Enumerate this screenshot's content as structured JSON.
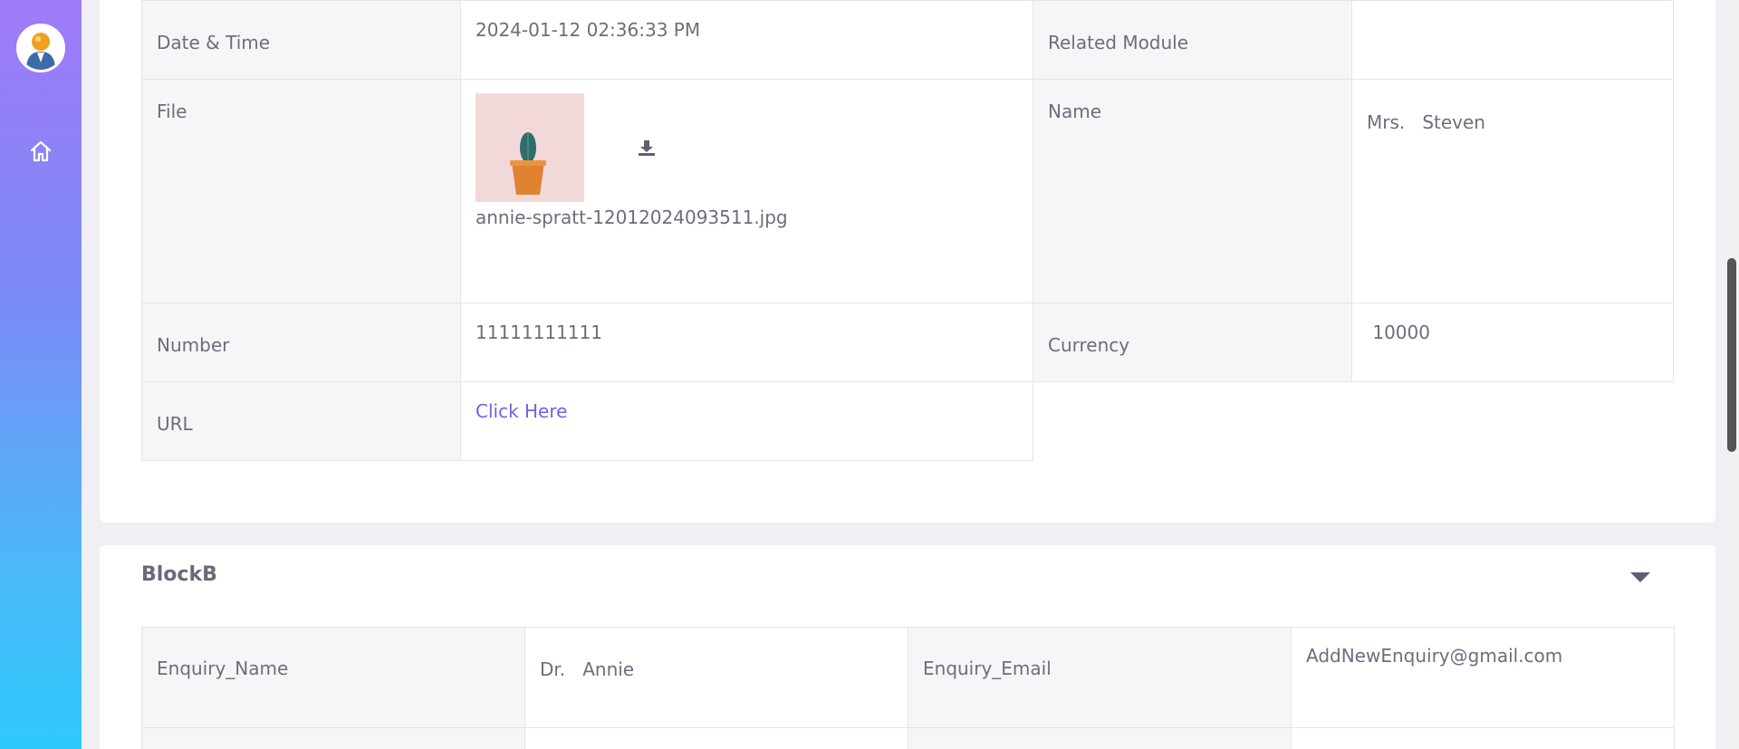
{
  "sidebar": {
    "avatar_icon": "user-avatar",
    "home_icon": "home-icon"
  },
  "block_a": {
    "rows": [
      {
        "label1": "Date & Time",
        "value1": "2024-01-12 02:36:33 PM",
        "label2": "Related Module",
        "value2": ""
      },
      {
        "label1": "File",
        "file_name": "annie-spratt-12012024093511.jpg",
        "label2": "Name",
        "value2": "Mrs.   Steven"
      },
      {
        "label1": "Number",
        "value1": "11111111111",
        "label2": "Currency",
        "value2": " 10000"
      },
      {
        "label1": "URL",
        "link_text": "Click Here"
      }
    ]
  },
  "block_b": {
    "title": "BlockB",
    "rows": [
      {
        "label1": "Enquiry_Name",
        "value1": "Dr.   Annie",
        "label2": "Enquiry_Email",
        "value2": "AddNewEnquiry@gmail.com"
      }
    ]
  },
  "colors": {
    "accent": "#6e62e6",
    "sidebar_top": "#a07af7",
    "sidebar_bottom": "#2ec9fa"
  }
}
